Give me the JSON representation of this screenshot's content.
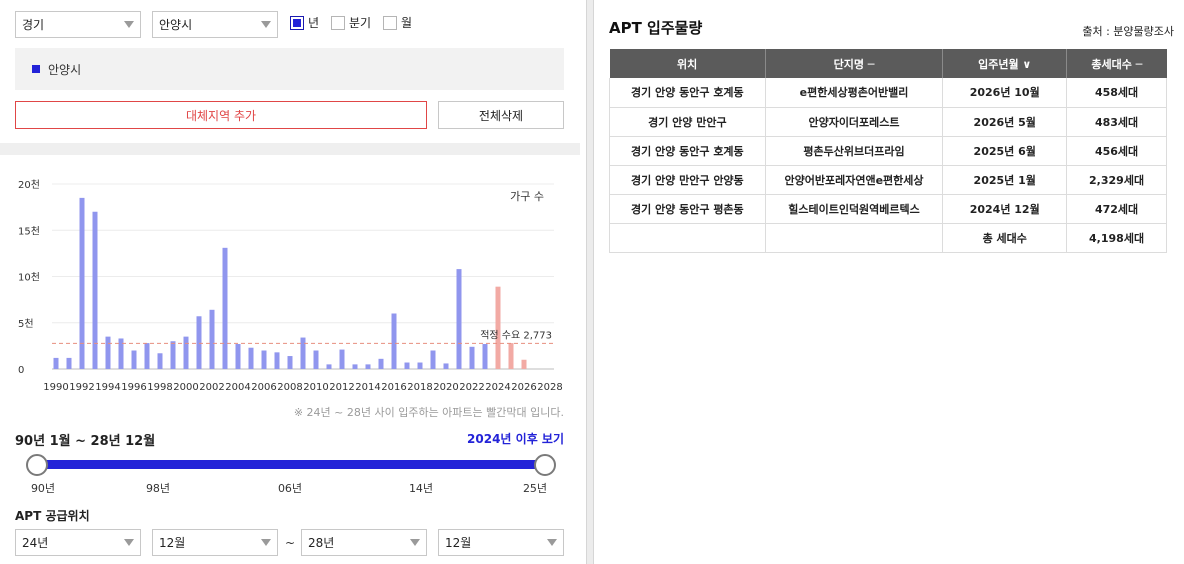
{
  "filters": {
    "province": "경기",
    "city": "안양시",
    "period_options": [
      {
        "label": "년",
        "checked": true
      },
      {
        "label": "분기",
        "checked": false
      },
      {
        "label": "월",
        "checked": false
      }
    ]
  },
  "region_list": [
    "안양시"
  ],
  "buttons": {
    "add_region": "대체지역 추가",
    "delete_all": "전체삭제"
  },
  "note": "※ 24년 ~ 28년 사이 입주하는 아파트는 빨간막대 입니다.",
  "range": {
    "label": "90년 1월 ~ 28년 12월",
    "after_link": "2024년 이후 보기",
    "ticks": [
      "90년",
      "98년",
      "06년",
      "14년",
      "25년"
    ]
  },
  "supply": {
    "title": "APT 공급위치",
    "from_year": "24년",
    "from_month": "12월",
    "to_year": "28년",
    "to_month": "12월",
    "separator": "~"
  },
  "colors": {
    "accent": "#2323d8",
    "bar": "#9096ee",
    "bar_future": "#f2aaa4",
    "demand_line": "#e88e7f",
    "danger": "#e04646"
  },
  "chart_data": {
    "type": "bar",
    "legend": "가구 수",
    "y_ticks": [
      "0",
      "5천",
      "10천",
      "15천",
      "20천"
    ],
    "ylim": [
      0,
      20000
    ],
    "x_tick_labels": [
      "1990",
      "1992",
      "1994",
      "1996",
      "1998",
      "2000",
      "2002",
      "2004",
      "2006",
      "2008",
      "2010",
      "2012",
      "2014",
      "2016",
      "2018",
      "2020",
      "2022",
      "2024",
      "2026",
      "2028"
    ],
    "demand": {
      "label": "적정 수요 2,773",
      "value": 2773
    },
    "series": [
      {
        "x": [
          1990,
          1991,
          1992,
          1993,
          1994,
          1995,
          1996,
          1997,
          1998,
          1999,
          2000,
          2001,
          2002,
          2003,
          2004,
          2005,
          2006,
          2007,
          2008,
          2009,
          2010,
          2011,
          2012,
          2013,
          2014,
          2015,
          2016,
          2017,
          2018,
          2019,
          2020,
          2021,
          2022,
          2023
        ],
        "values": [
          1200,
          1200,
          18500,
          17000,
          3500,
          3300,
          2000,
          2800,
          1700,
          3000,
          3500,
          5700,
          6400,
          13100,
          2700,
          2300,
          2000,
          1800,
          1400,
          3400,
          2000,
          500,
          2100,
          500,
          500,
          1100,
          6000,
          700,
          700,
          2000,
          600,
          10800,
          2400,
          2700
        ]
      },
      {
        "x": [
          2024,
          2025,
          2026
        ],
        "values": [
          8900,
          2800,
          1000
        ]
      }
    ]
  },
  "right_panel": {
    "title": "APT 입주물량",
    "source": "출처 : 분양물량조사",
    "columns": [
      "위치",
      "단지명 ─",
      "입주년월 ∨",
      "총세대수 ─"
    ],
    "rows": [
      [
        "경기 안양 동안구 호계동",
        "e편한세상평촌어반밸리",
        "2026년 10월",
        "458세대"
      ],
      [
        "경기 안양 만안구",
        "안양자이더포레스트",
        "2026년 5월",
        "483세대"
      ],
      [
        "경기 안양 동안구 호계동",
        "평촌두산위브더프라임",
        "2025년 6월",
        "456세대"
      ],
      [
        "경기 안양 만안구 안양동",
        "안양어반포레자연앤e편한세상",
        "2025년 1월",
        "2,329세대"
      ],
      [
        "경기 안양 동안구 평촌동",
        "힐스테이트인덕원역베르텍스",
        "2024년 12월",
        "472세대"
      ]
    ],
    "total_label": "총 세대수",
    "total_value": "4,198세대"
  }
}
